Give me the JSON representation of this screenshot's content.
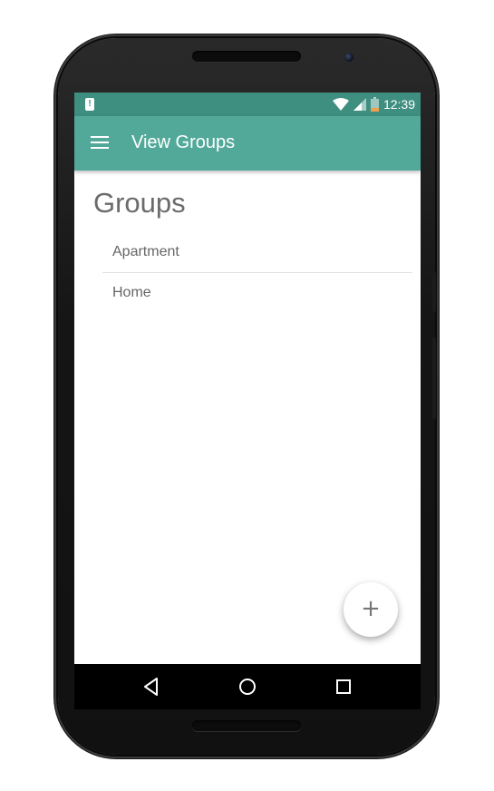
{
  "status_bar": {
    "time": "12:39",
    "alert_glyph": "!",
    "icons": [
      "alert-icon",
      "wifi-icon",
      "signal-icon",
      "battery-icon"
    ]
  },
  "toolbar": {
    "title": "View Groups",
    "menu_icon": "hamburger-menu-icon"
  },
  "page": {
    "title": "Groups"
  },
  "groups": [
    {
      "label": "Apartment"
    },
    {
      "label": "Home"
    }
  ],
  "fab": {
    "label": "+",
    "icon": "add-icon"
  },
  "nav_bar": {
    "icons": [
      "back-icon",
      "home-icon",
      "recents-icon"
    ]
  },
  "colors": {
    "status_bar": "#3f8f80",
    "toolbar": "#52a99a",
    "text_secondary": "#666666"
  }
}
